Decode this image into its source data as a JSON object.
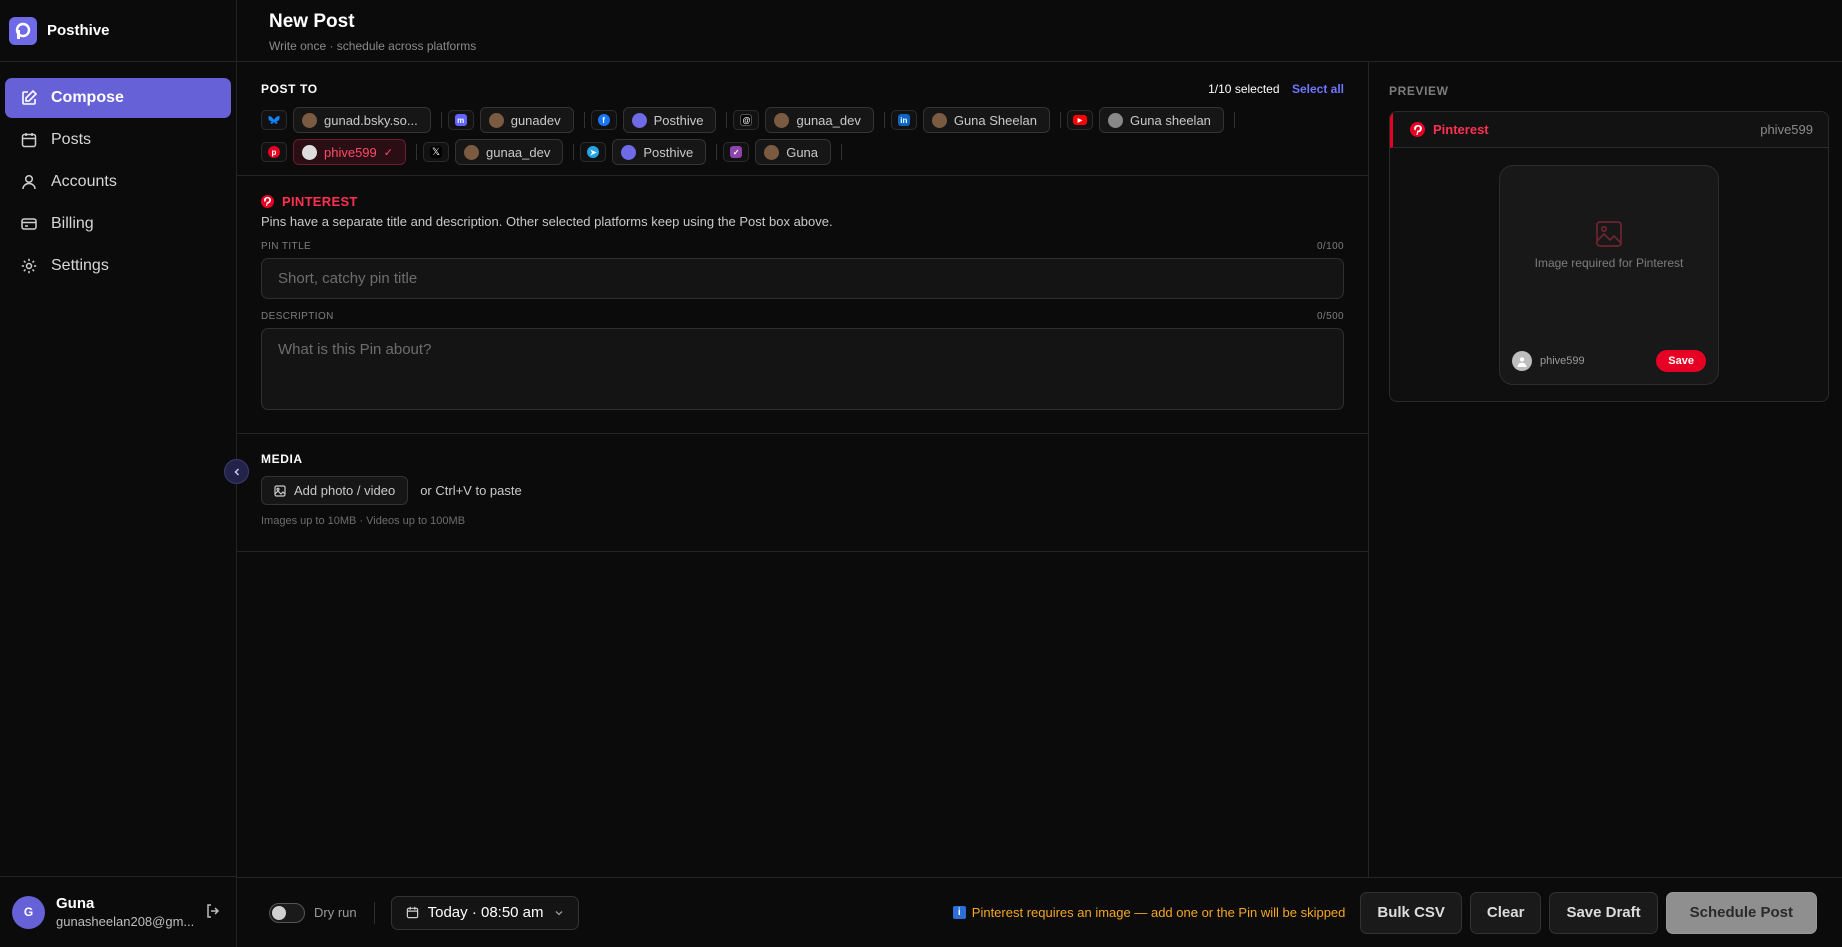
{
  "app": {
    "name": "Posthive"
  },
  "sidebar": {
    "items": [
      {
        "label": "Compose",
        "icon": "compose-icon",
        "active": true
      },
      {
        "label": "Posts",
        "icon": "calendar-icon",
        "active": false
      },
      {
        "label": "Accounts",
        "icon": "user-icon",
        "active": false
      },
      {
        "label": "Billing",
        "icon": "card-icon",
        "active": false
      },
      {
        "label": "Settings",
        "icon": "gear-icon",
        "active": false
      }
    ],
    "user": {
      "initial": "G",
      "name": "Guna",
      "email": "gunasheelan208@gm..."
    }
  },
  "header": {
    "title": "New Post",
    "subtitle": "Write once · schedule across platforms"
  },
  "post_to": {
    "label": "POST TO",
    "selected_count": "1/10 selected",
    "select_all": "Select all",
    "row1": [
      {
        "platform": "bluesky",
        "color": "#1185fe",
        "account": "gunad.bsky.so..."
      },
      {
        "platform": "mastodon",
        "color": "#6364ff",
        "account": "gunadev"
      },
      {
        "platform": "facebook",
        "color": "#1877f2",
        "account": "Posthive"
      },
      {
        "platform": "threads",
        "color": "#000000",
        "account": "gunaa_dev"
      },
      {
        "platform": "linkedin",
        "color": "#0a66c2",
        "account": "Guna Sheelan"
      },
      {
        "platform": "youtube",
        "color": "#ff0000",
        "account": "Guna sheelan"
      }
    ],
    "row2": [
      {
        "platform": "pinterest",
        "color": "#e60023",
        "account": "phive599",
        "selected": true
      },
      {
        "platform": "x",
        "color": "#000000",
        "account": "gunaa_dev"
      },
      {
        "platform": "telegram",
        "color": "#26a5e4",
        "account": "Posthive"
      },
      {
        "platform": "other",
        "color": "#8e44ad",
        "account": "Guna"
      }
    ]
  },
  "pinterest": {
    "heading": "PINTEREST",
    "description": "Pins have a separate title and description. Other selected platforms keep using the Post box above.",
    "title_label": "PIN TITLE",
    "title_count": "0/100",
    "title_placeholder": "Short, catchy pin title",
    "desc_label": "DESCRIPTION",
    "desc_count": "0/500",
    "desc_placeholder": "What is this Pin about?"
  },
  "media": {
    "label": "MEDIA",
    "add_button": "Add photo / video",
    "paste_hint": "or Ctrl+V to paste",
    "limits": "Images up to 10MB · Videos up to 100MB"
  },
  "preview": {
    "label": "PREVIEW",
    "platform": "Pinterest",
    "account": "phive599",
    "image_placeholder": "Image required for Pinterest",
    "pin_user": "phive599",
    "save_label": "Save"
  },
  "bottom": {
    "dry_run": "Dry run",
    "schedule_time": "Today · 08:50 am",
    "warning": "Pinterest requires an image — add one or the Pin will be skipped",
    "bulk_csv": "Bulk CSV",
    "clear": "Clear",
    "save_draft": "Save Draft",
    "schedule": "Schedule Post"
  }
}
